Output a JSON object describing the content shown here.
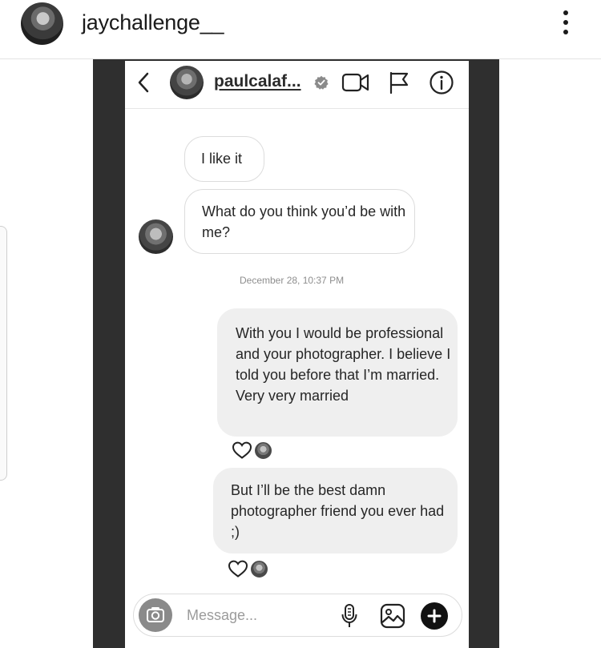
{
  "post": {
    "username": "jaychallenge__"
  },
  "chat": {
    "contact_name": "paulcalaf...",
    "messages": [
      {
        "id": "m1",
        "direction": "in",
        "text": "I like it"
      },
      {
        "id": "m2",
        "direction": "in",
        "text": "What do you think you’d be with me?"
      },
      {
        "id": "m3",
        "direction": "out",
        "text": "With you I would be professional and your photographer. I believe I told you before that I’m married. Very very married"
      },
      {
        "id": "m4",
        "direction": "out",
        "text": "But I’ll be the best damn photographer friend you ever had ;)"
      }
    ],
    "timestamp": "December 28, 10:37 PM"
  },
  "composer": {
    "placeholder": "Message..."
  },
  "icons": {
    "header": [
      "back-icon",
      "verified-icon",
      "video-call-icon",
      "flag-icon",
      "info-icon"
    ],
    "composer": [
      "camera-icon",
      "mic-icon",
      "gallery-icon",
      "plus-icon"
    ],
    "reactions": [
      "heart-icon"
    ]
  }
}
